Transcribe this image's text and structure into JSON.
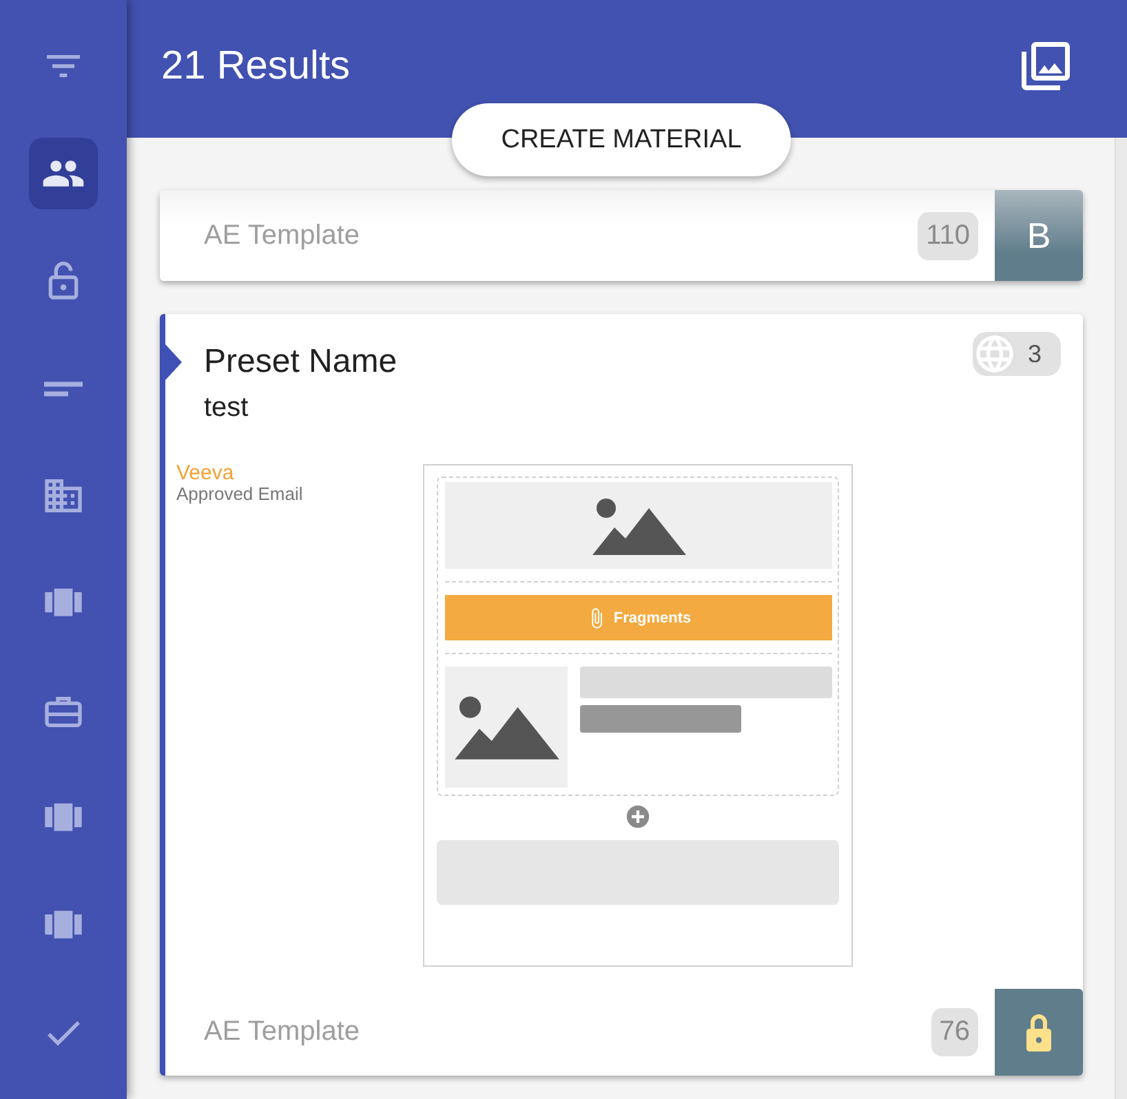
{
  "sidebar": {
    "items": [
      {
        "selected": false
      },
      {
        "selected": true
      },
      {
        "selected": false
      },
      {
        "selected": false
      },
      {
        "selected": false
      },
      {
        "selected": false
      },
      {
        "selected": false
      },
      {
        "selected": false
      },
      {
        "selected": false
      },
      {
        "selected": false
      }
    ]
  },
  "header": {
    "title": "21 Results"
  },
  "create_button": {
    "label": "CREATE MATERIAL"
  },
  "cards": [
    {
      "kind": "collapsed",
      "selected": false,
      "template": "AE Template",
      "count": "110",
      "tile": {
        "kind": "letter",
        "text": "B"
      }
    },
    {
      "kind": "expanded",
      "selected": true,
      "title": "Preset Name",
      "subtitle": "test",
      "language_count": "3",
      "brand": {
        "logo": "Veeva",
        "caption": "Approved Email"
      },
      "preview": {
        "fragment_label": "Fragments"
      },
      "template": "AE Template",
      "count": "76",
      "tile": {
        "kind": "lock"
      }
    }
  ]
}
